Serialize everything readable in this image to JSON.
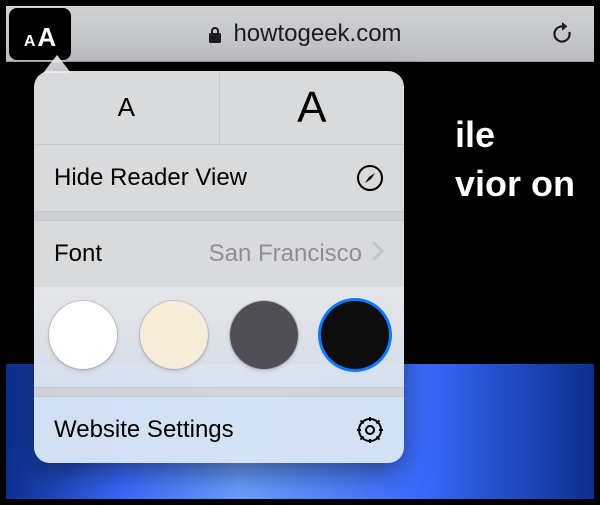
{
  "address_bar": {
    "aa_small": "A",
    "aa_big": "A",
    "domain": "howtogeek.com"
  },
  "article": {
    "line1": "ile",
    "line2": "vior on"
  },
  "popover": {
    "font_size_small": "A",
    "font_size_large": "A",
    "hide_reader_label": "Hide Reader View",
    "font_label": "Font",
    "font_value": "San Francisco",
    "website_settings_label": "Website Settings",
    "themes": {
      "white": "#ffffff",
      "sepia": "#f5ecd9",
      "grey": "#4f4f55",
      "black": "#0d0d0e"
    },
    "selected_theme": "black"
  }
}
